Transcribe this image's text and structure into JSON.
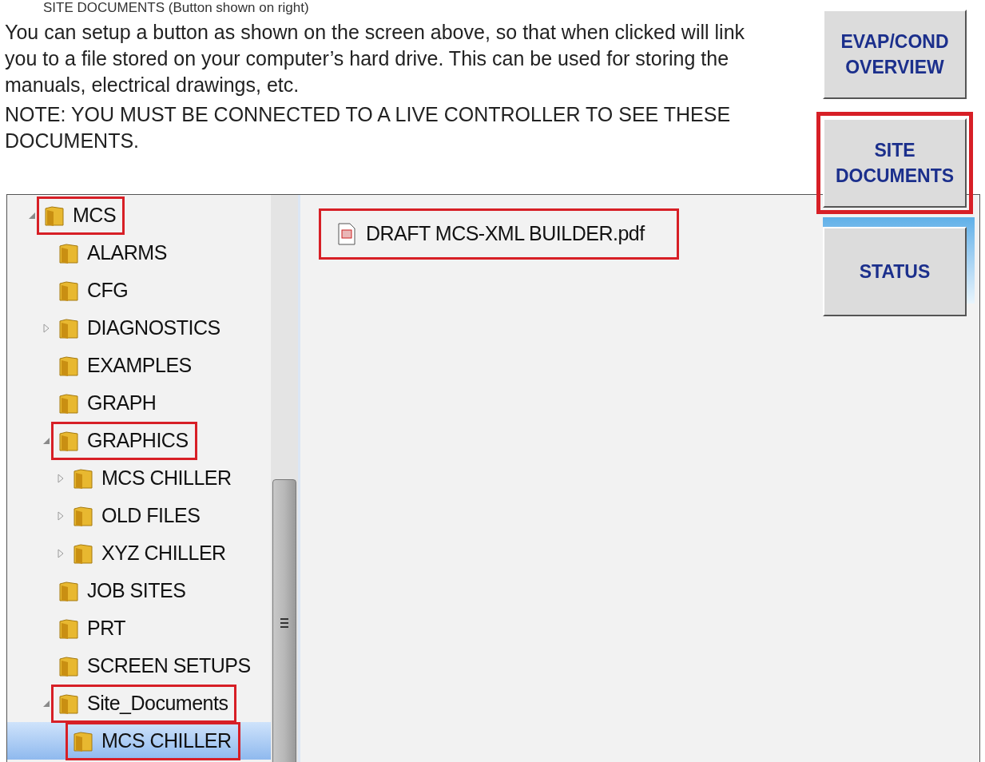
{
  "heading": "SITE DOCUMENTS (Button shown on right)",
  "paragraphs": [
    "You can setup a button as shown on the screen above, so that when clicked will link you to a file stored on your computer’s hard drive. This can be used for storing the manuals, electrical drawings, etc.",
    "NOTE: YOU MUST BE CONNECTED TO A LIVE CONTROLLER TO SEE THESE DOCUMENTS."
  ],
  "side_buttons": [
    {
      "label": "EVAP/COND OVERVIEW",
      "highlighted": false
    },
    {
      "label": "SITE DOCUMENTS",
      "highlighted": true
    },
    {
      "label": "STATUS",
      "highlighted": false
    }
  ],
  "folder_tree": [
    {
      "label": "MCS",
      "expanded": true,
      "highlighted": true,
      "selected": false,
      "children": [
        {
          "label": "ALARMS",
          "highlighted": false,
          "selected": false
        },
        {
          "label": "CFG",
          "highlighted": false,
          "selected": false
        },
        {
          "label": "DIAGNOSTICS",
          "expanded": false,
          "highlighted": false,
          "selected": false
        },
        {
          "label": "EXAMPLES",
          "highlighted": false,
          "selected": false
        },
        {
          "label": "GRAPH",
          "highlighted": false,
          "selected": false
        },
        {
          "label": "GRAPHICS",
          "expanded": true,
          "highlighted": true,
          "selected": false,
          "children": [
            {
              "label": "MCS CHILLER",
              "expanded": false,
              "highlighted": false,
              "selected": false
            },
            {
              "label": "OLD FILES",
              "expanded": false,
              "highlighted": false,
              "selected": false
            },
            {
              "label": "XYZ CHILLER",
              "expanded": false,
              "highlighted": false,
              "selected": false
            }
          ]
        },
        {
          "label": "JOB SITES",
          "highlighted": false,
          "selected": false
        },
        {
          "label": "PRT",
          "highlighted": false,
          "selected": false
        },
        {
          "label": "SCREEN SETUPS",
          "highlighted": false,
          "selected": false
        },
        {
          "label": "Site_Documents",
          "expanded": true,
          "highlighted": true,
          "selected": false,
          "children": [
            {
              "label": "MCS CHILLER",
              "highlighted": true,
              "selected": true
            }
          ]
        }
      ]
    }
  ],
  "files": [
    {
      "name": "DRAFT MCS-XML BUILDER.pdf",
      "highlighted": true
    }
  ]
}
